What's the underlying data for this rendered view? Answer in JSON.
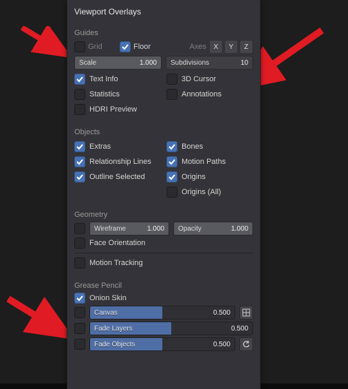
{
  "panel": {
    "title": "Viewport Overlays"
  },
  "guides": {
    "header": "Guides",
    "grid_label": "Grid",
    "floor_label": "Floor",
    "axes_label": "Axes",
    "axis_x": "X",
    "axis_y": "Y",
    "axis_z": "Z",
    "scale_label": "Scale",
    "scale_value": "1.000",
    "subdiv_label": "Subdivisions",
    "subdiv_value": "10",
    "text_info_label": "Text Info",
    "cursor3d_label": "3D Cursor",
    "stats_label": "Statistics",
    "annotations_label": "Annotations",
    "hdri_label": "HDRI Preview"
  },
  "objects": {
    "header": "Objects",
    "extras_label": "Extras",
    "bones_label": "Bones",
    "rel_lines_label": "Relationship Lines",
    "motion_paths_label": "Motion Paths",
    "outline_sel_label": "Outline Selected",
    "origins_label": "Origins",
    "origins_all_label": "Origins (All)"
  },
  "geometry": {
    "header": "Geometry",
    "wireframe_label": "Wireframe",
    "wireframe_value": "1.000",
    "opacity_label": "Opacity",
    "opacity_value": "1.000",
    "face_orient_label": "Face Orientation",
    "motion_tracking_label": "Motion Tracking"
  },
  "gpencil": {
    "header": "Grease Pencil",
    "onion_label": "Onion Skin",
    "canvas_label": "Canvas",
    "canvas_value": "0.500",
    "fade_layers_label": "Fade Layers",
    "fade_layers_value": "0.500",
    "fade_objects_label": "Fade Objects",
    "fade_objects_value": "0.500"
  },
  "chart_data": {
    "type": "table",
    "title": "Viewport Overlays settings",
    "series": [
      {
        "name": "Guides",
        "items": [
          {
            "label": "Grid",
            "checked": false
          },
          {
            "label": "Floor",
            "checked": true
          },
          {
            "label": "Axes X",
            "checked": false
          },
          {
            "label": "Axes Y",
            "checked": false
          },
          {
            "label": "Axes Z",
            "checked": false
          },
          {
            "label": "Scale",
            "value": 1.0
          },
          {
            "label": "Subdivisions",
            "value": 10
          },
          {
            "label": "Text Info",
            "checked": true
          },
          {
            "label": "3D Cursor",
            "checked": false
          },
          {
            "label": "Statistics",
            "checked": false
          },
          {
            "label": "Annotations",
            "checked": false
          },
          {
            "label": "HDRI Preview",
            "checked": false
          }
        ]
      },
      {
        "name": "Objects",
        "items": [
          {
            "label": "Extras",
            "checked": true
          },
          {
            "label": "Bones",
            "checked": true
          },
          {
            "label": "Relationship Lines",
            "checked": true
          },
          {
            "label": "Motion Paths",
            "checked": true
          },
          {
            "label": "Outline Selected",
            "checked": true
          },
          {
            "label": "Origins",
            "checked": true
          },
          {
            "label": "Origins (All)",
            "checked": false
          }
        ]
      },
      {
        "name": "Geometry",
        "items": [
          {
            "label": "Wireframe",
            "enabled": false,
            "value": 1.0
          },
          {
            "label": "Opacity",
            "value": 1.0
          },
          {
            "label": "Face Orientation",
            "checked": false
          },
          {
            "label": "Motion Tracking",
            "checked": false
          }
        ]
      },
      {
        "name": "Grease Pencil",
        "items": [
          {
            "label": "Onion Skin",
            "checked": true
          },
          {
            "label": "Canvas",
            "enabled": false,
            "value": 0.5
          },
          {
            "label": "Fade Layers",
            "enabled": false,
            "value": 0.5
          },
          {
            "label": "Fade Objects",
            "enabled": false,
            "value": 0.5
          }
        ]
      }
    ]
  }
}
